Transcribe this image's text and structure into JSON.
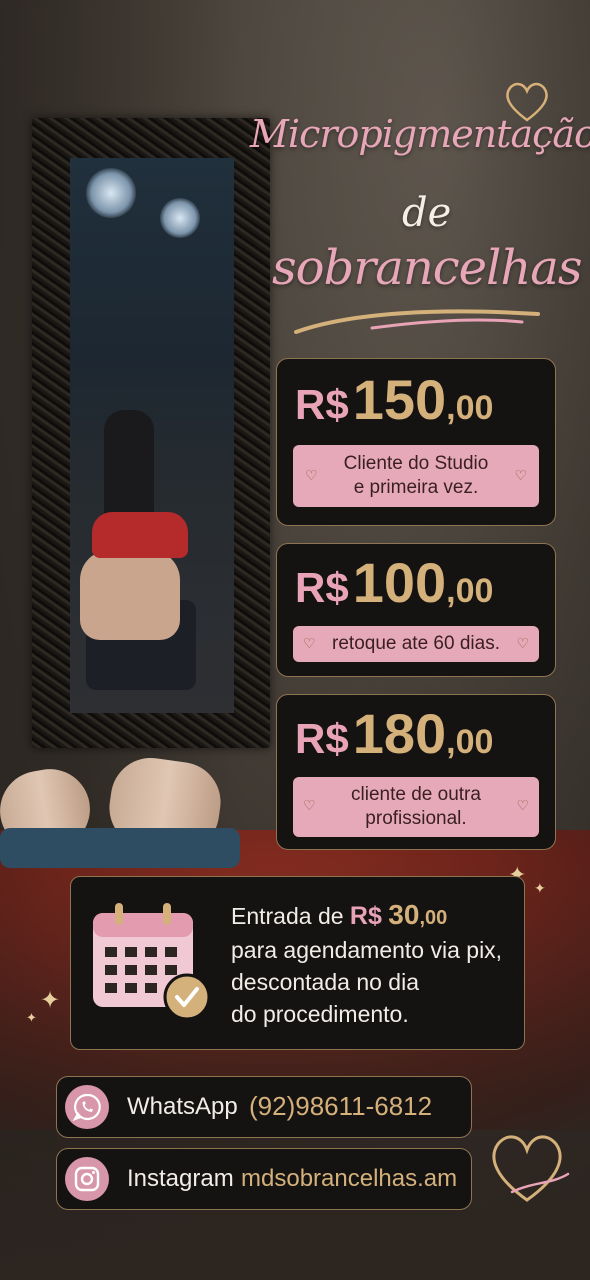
{
  "title": {
    "line1": "Micropigmentação",
    "line2": "de",
    "line3": "sobrancelhas"
  },
  "prices": [
    {
      "currency": "R$",
      "amount": "150",
      "cents": ",00",
      "desc_line1": "Cliente do Studio",
      "desc_line2": "e primeira vez."
    },
    {
      "currency": "R$",
      "amount": "100",
      "cents": ",00",
      "desc_line1": "retoque ate 60 dias.",
      "desc_line2": ""
    },
    {
      "currency": "R$",
      "amount": "180",
      "cents": ",00",
      "desc_line1": "cliente de outra",
      "desc_line2": "profissional."
    }
  ],
  "deposit": {
    "prefix": "Entrada de",
    "currency": "R$",
    "amount": "30",
    "cents": ",00",
    "line2": "para agendamento via pix,",
    "line3": "descontada no dia",
    "line4": "do procedimento."
  },
  "contacts": {
    "whatsapp": {
      "label": "WhatsApp",
      "value": "(92)98611-6812",
      "icon": "whatsapp-icon"
    },
    "instagram": {
      "label": "Instagram",
      "value": "mdsobrancelhas.am",
      "icon": "instagram-icon"
    }
  },
  "colors": {
    "pink": "#e8a3b7",
    "gold": "#d4b07a",
    "card_bg": "#151312"
  }
}
